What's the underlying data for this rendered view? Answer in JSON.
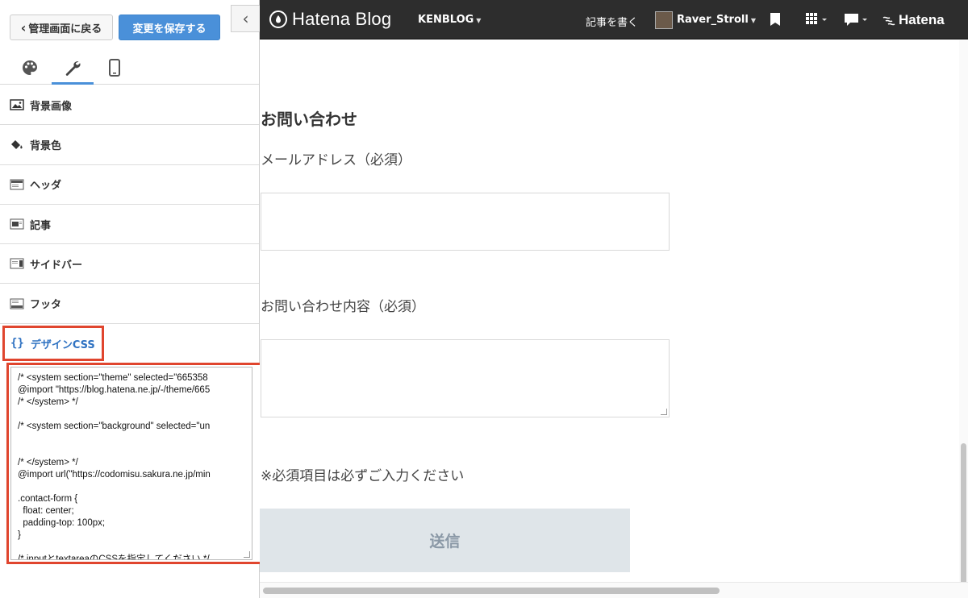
{
  "left_panel": {
    "back_button": "管理画面に戻る",
    "save_button": "変更を保存する",
    "collapse_glyph": "‹",
    "tabs": [
      {
        "icon": "palette-icon",
        "active": false
      },
      {
        "icon": "wrench-icon",
        "active": true
      },
      {
        "icon": "smartphone-icon",
        "active": false
      }
    ],
    "menu": [
      {
        "label": "背景画像",
        "icon": "image-icon"
      },
      {
        "label": "背景色",
        "icon": "paint-bucket-icon"
      },
      {
        "label": "ヘッダ",
        "icon": "header-layout-icon"
      },
      {
        "label": "記事",
        "icon": "article-layout-icon"
      },
      {
        "label": "サイドバー",
        "icon": "sidebar-layout-icon"
      },
      {
        "label": "フッタ",
        "icon": "footer-layout-icon"
      }
    ],
    "design_css": {
      "label": "デザインCSS",
      "brace": "{}",
      "code": "/* <system section=\"theme\" selected=\"665358\n@import \"https://blog.hatena.ne.jp/-/theme/665\n/* </system> */\n\n/* <system section=\"background\" selected=\"un\n\n\n/* </system> */\n@import url(\"https://codomisu.sakura.ne.jp/min\n\n.contact-form {\n  float: center;\n  padding-top: 100px;\n}\n\n/* inputとtextareaのCSSを指定してください */"
    }
  },
  "header": {
    "logo_text": "Hatena Blog",
    "blog_name": "KENBLOG",
    "write_label": "記事を書く",
    "username": "Raver_Stroll",
    "brand": "Hatena"
  },
  "form": {
    "heading": "お問い合わせ",
    "email_label": "メールアドレス（必須）",
    "message_label": "お問い合わせ内容（必須）",
    "required_note": "※必須項目は必ずご入力ください",
    "submit_label": "送信"
  },
  "colors": {
    "accent": "#4a90d9",
    "highlight": "#e0452e",
    "header_bg": "#2d2d2d",
    "submit_bg": "#dfe5e9"
  }
}
